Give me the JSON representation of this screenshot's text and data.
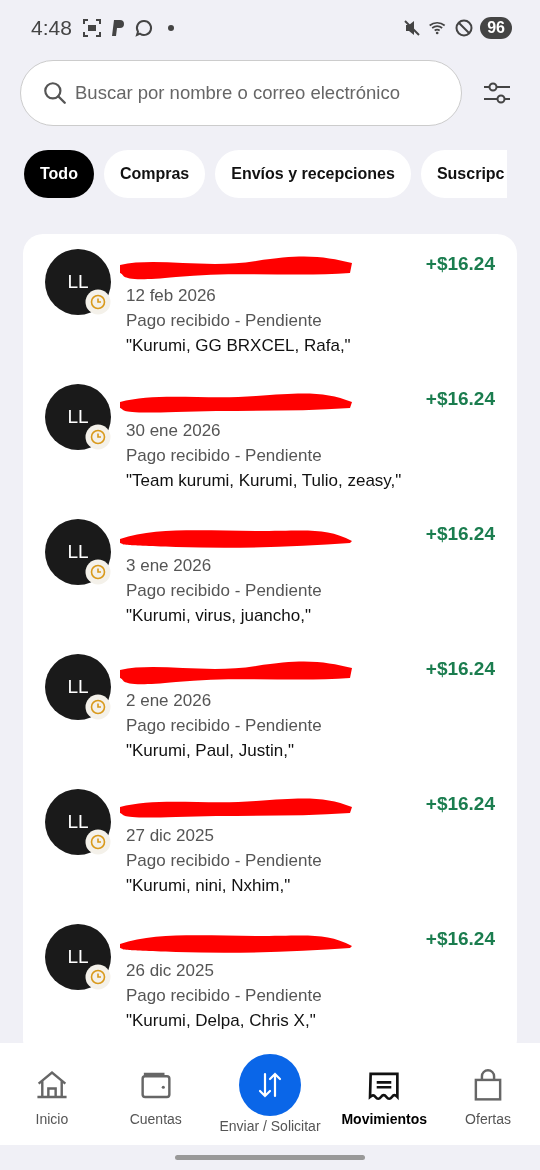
{
  "status_bar": {
    "time": "4:48",
    "battery": "96"
  },
  "search": {
    "placeholder": "Buscar por nombre o correo electrónico"
  },
  "filters": [
    {
      "label": "Todo",
      "selected": true
    },
    {
      "label": "Compras",
      "selected": false
    },
    {
      "label": "Envíos y recepciones",
      "selected": false
    },
    {
      "label": "Suscripc",
      "selected": false
    }
  ],
  "transactions": [
    {
      "initials": "LL",
      "pending": true,
      "redacted": true,
      "date": "12 feb 2026",
      "status": "Pago recibido - Pendiente",
      "note": "\"Kurumi, GG BRXCEL, Rafa,\"",
      "amount": "+$16.24"
    },
    {
      "initials": "LL",
      "pending": true,
      "redacted": true,
      "date": "30 ene 2026",
      "status": "Pago recibido - Pendiente",
      "note": "\"Team kurumi, Kurumi, Tulio, zeasy,\"",
      "amount": "+$16.24"
    },
    {
      "initials": "LL",
      "pending": true,
      "redacted": true,
      "date": "3 ene 2026",
      "status": "Pago recibido - Pendiente",
      "note": "\"Kurumi, virus, juancho,\"",
      "amount": "+$16.24"
    },
    {
      "initials": "LL",
      "pending": true,
      "redacted": true,
      "date": "2 ene 2026",
      "status": "Pago recibido - Pendiente",
      "note": "\"Kurumi, Paul, Justin,\"",
      "amount": "+$16.24"
    },
    {
      "initials": "LL",
      "pending": true,
      "redacted": true,
      "date": "27 dic 2025",
      "status": "Pago recibido - Pendiente",
      "note": "\"Kurumi, nini, Nxhim,\"",
      "amount": "+$16.24"
    },
    {
      "initials": "LL",
      "pending": true,
      "redacted": true,
      "date": "26 dic 2025",
      "status": "Pago recibido - Pendiente",
      "note": "\"Kurumi, Delpa, Chris X,\"",
      "amount": "+$16.24"
    }
  ],
  "nav": [
    {
      "kind": "home",
      "label": "Inicio",
      "selected": false
    },
    {
      "kind": "wallet",
      "label": "Cuentas",
      "selected": false
    },
    {
      "kind": "action",
      "label": "Enviar / Solicitar",
      "selected": false
    },
    {
      "kind": "receipt",
      "label": "Movimientos",
      "selected": true
    },
    {
      "kind": "bag",
      "label": "Ofertas",
      "selected": false
    }
  ]
}
